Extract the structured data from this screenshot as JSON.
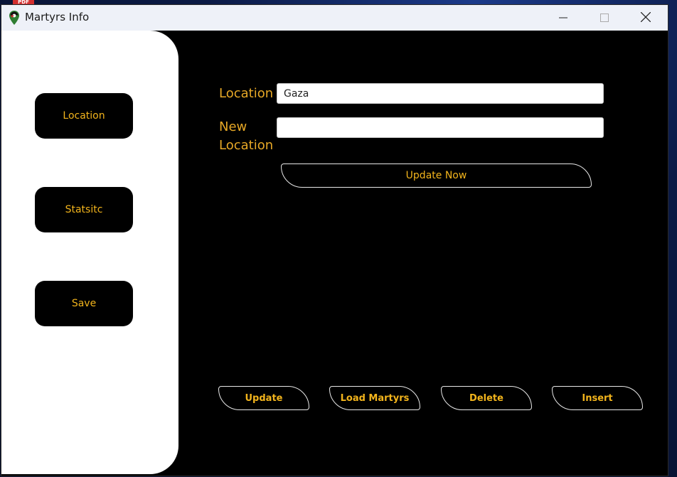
{
  "desktop": {
    "badge": "PDF"
  },
  "window": {
    "title": "Martyrs Info"
  },
  "sidebar": {
    "items": [
      {
        "label": "Location"
      },
      {
        "label": "Statsitc"
      },
      {
        "label": "Save"
      }
    ]
  },
  "form": {
    "location_label": "Location",
    "location_value": "Gaza",
    "new_location_label_line1": "New",
    "new_location_label_line2": "Location",
    "new_location_value": "",
    "update_now_label": "Update Now"
  },
  "actions": {
    "update_label": "Update",
    "load_label": "Load Martyrs",
    "delete_label": "Delete",
    "insert_label": "Insert"
  },
  "colors": {
    "accent": "#f2b41c",
    "label": "#e7a826",
    "background": "#000000",
    "sidebar": "#ffffff"
  }
}
